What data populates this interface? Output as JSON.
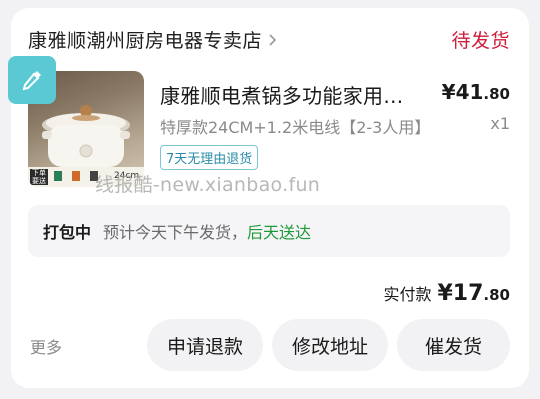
{
  "store": {
    "name": "康雅顺潮州厨房电器专卖店",
    "order_status": "待发货"
  },
  "product": {
    "title": "康雅顺电煮锅多功能家用…",
    "price_symbol": "¥",
    "price_int": "41",
    "price_dec": ".80",
    "spec": "特厚款24CM+1.2米电线【2-3人用】",
    "quantity": "x1",
    "return_tag": "7天无理由退货",
    "image_labels": {
      "badge": "下单要送",
      "size": "24cm"
    }
  },
  "watermark": "线报酷-new.xianbao.fun",
  "shipping": {
    "label": "打包中",
    "text": "预计今天下午发货，",
    "highlight": "后天送达"
  },
  "payment": {
    "label": "实付款",
    "symbol": "¥",
    "amount_int": "17",
    "amount_dec": ".80"
  },
  "actions": {
    "more": "更多",
    "refund": "申请退款",
    "change_address": "修改地址",
    "urge_shipping": "催发货"
  },
  "colors": {
    "status_red": "#cc1f3d",
    "green": "#1f9a3a",
    "tag_blue": "#2a8ca8",
    "float_teal": "#5bc9d4"
  }
}
